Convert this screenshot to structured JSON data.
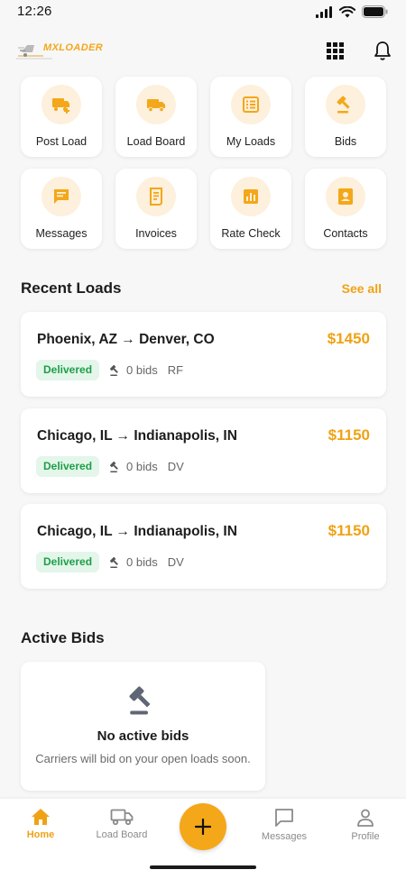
{
  "status_bar": {
    "time": "12:26"
  },
  "header": {
    "logo_text": "MXLOADER",
    "icons": {
      "grid": "apps-grid-icon",
      "notifications": "bell-icon"
    }
  },
  "quick_actions": [
    {
      "label": "Post Load",
      "icon": "truck-plus-icon"
    },
    {
      "label": "Load Board",
      "icon": "truck-icon"
    },
    {
      "label": "My Loads",
      "icon": "list-icon"
    },
    {
      "label": "Bids",
      "icon": "gavel-icon"
    },
    {
      "label": "Messages",
      "icon": "message-icon"
    },
    {
      "label": "Invoices",
      "icon": "receipt-icon"
    },
    {
      "label": "Rate Check",
      "icon": "bar-chart-icon"
    },
    {
      "label": "Contacts",
      "icon": "contacts-icon"
    }
  ],
  "recent_loads": {
    "title": "Recent Loads",
    "see_all": "See all",
    "items": [
      {
        "route": "Phoenix, AZ → Denver, CO",
        "price": "$1450",
        "status": "Delivered",
        "bids": "0 bids",
        "initials": "RF"
      },
      {
        "route": "Chicago, IL → Indianapolis, IN",
        "price": "$1150",
        "status": "Delivered",
        "bids": "0 bids",
        "initials": "DV"
      },
      {
        "route": "Chicago, IL → Indianapolis, IN",
        "price": "$1150",
        "status": "Delivered",
        "bids": "0 bids",
        "initials": "DV"
      }
    ]
  },
  "active_bids": {
    "title": "Active Bids",
    "empty_title": "No active bids",
    "empty_subtitle": "Carriers will bid on your open loads soon."
  },
  "bottom_nav": {
    "items": [
      {
        "label": "Home",
        "icon": "home-icon",
        "active": true
      },
      {
        "label": "Load Board",
        "icon": "truck-icon",
        "active": false
      },
      {
        "label": "Messages",
        "icon": "chat-icon",
        "active": false
      },
      {
        "label": "Profile",
        "icon": "person-icon",
        "active": false
      }
    ],
    "fab_icon": "plus-icon"
  },
  "colors": {
    "accent": "#f4a718",
    "accent_text": "#f0a214",
    "tile_icon_bg": "#fdf0dc",
    "success_bg": "#e4f6ea",
    "success_text": "#1e9e4a",
    "background": "#f7f7f7"
  }
}
